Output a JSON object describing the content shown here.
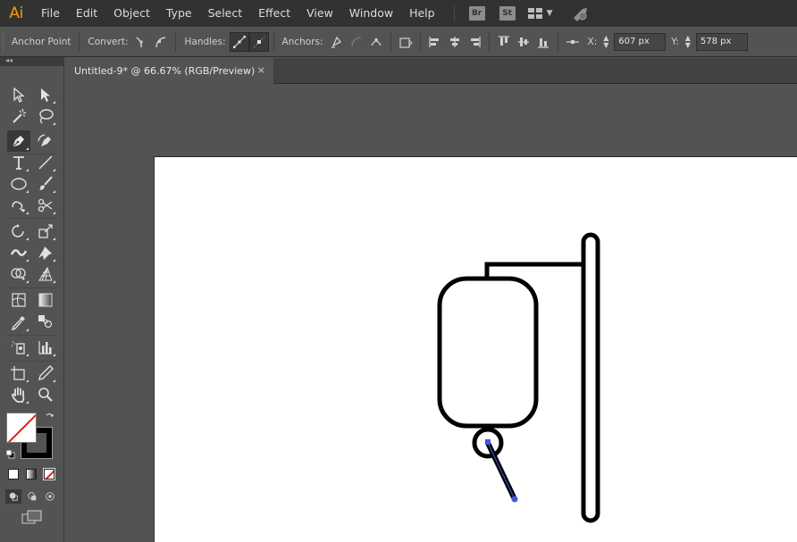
{
  "app": {
    "logo": "Ai"
  },
  "menu": [
    "File",
    "Edit",
    "Object",
    "Type",
    "Select",
    "Effect",
    "View",
    "Window",
    "Help"
  ],
  "app_buttons": {
    "bridge": "Br",
    "stock": "St"
  },
  "control_bar": {
    "tool_label": "Anchor Point",
    "convert_label": "Convert:",
    "handles_label": "Handles:",
    "anchors_label": "Anchors:",
    "x_label": "X:",
    "x_value": "607 px",
    "y_label": "Y:",
    "y_value": "578 px"
  },
  "document_tab": {
    "title": "Untitled-9* @ 66.67% (RGB/Preview)",
    "close": "×"
  },
  "tools": [
    "selection-tool",
    "direct-selection-tool",
    "magic-wand-tool",
    "lasso-tool",
    "pen-tool",
    "curvature-tool",
    "type-tool",
    "line-segment-tool",
    "ellipse-tool",
    "paintbrush-tool",
    "shaper-tool",
    "scissors-tool",
    "rotate-tool",
    "scale-tool",
    "width-tool",
    "puppet-warp-tool",
    "shape-builder-tool",
    "perspective-grid-tool",
    "mesh-tool",
    "gradient-tool",
    "eyedropper-tool",
    "blend-tool",
    "symbol-sprayer-tool",
    "column-graph-tool",
    "artboard-tool",
    "slice-tool",
    "hand-tool",
    "zoom-tool"
  ],
  "selected_tool": "pen-tool",
  "colors": {
    "stroke": "#000000",
    "fill": "none",
    "path_highlight": "#3d5bd6",
    "accent_logo": "#ff9a00"
  }
}
